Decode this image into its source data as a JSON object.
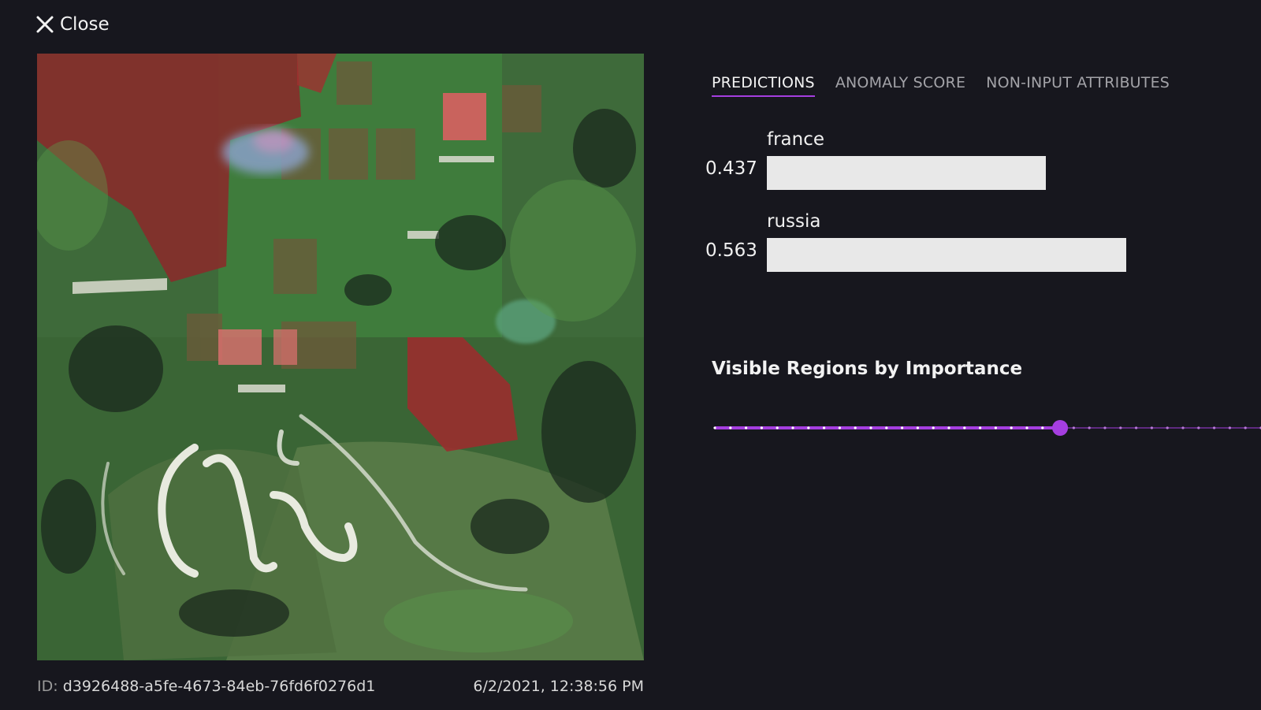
{
  "close": {
    "label": "Close",
    "icon": "close-icon"
  },
  "tabs": [
    {
      "label": "PREDICTIONS",
      "active": true
    },
    {
      "label": "ANOMALY SCORE",
      "active": false
    },
    {
      "label": "NON-INPUT ATTRIBUTES",
      "active": false
    }
  ],
  "predictions": [
    {
      "label": "france",
      "score": "0.437",
      "value": 0.437
    },
    {
      "label": "russia",
      "score": "0.563",
      "value": 0.563
    }
  ],
  "regions": {
    "title": "Visible Regions by Importance",
    "slider_fraction": 0.63,
    "tick_count": 36
  },
  "meta": {
    "id_prefix": "ID:",
    "id_value": "d3926488-a5fe-4673-84eb-76fd6f0276d1",
    "timestamp": "6/2/2021, 12:38:56 PM"
  },
  "colors": {
    "accent": "#a53ee0",
    "bar": "#e8e8e8",
    "background": "#17171e"
  }
}
